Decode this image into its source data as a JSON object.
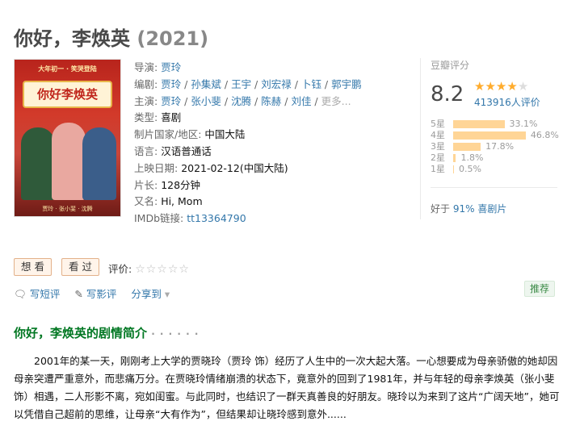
{
  "title": {
    "name": "你好，李焕英",
    "year": "(2021)"
  },
  "poster": {
    "top_text": "大年初一 · 笑哭登陆",
    "title_text": "你好李焕英",
    "bottom_text": "贾玲 · 张小斐 · 沈腾"
  },
  "info": {
    "director_label": "导演: ",
    "director": "贾玲",
    "writer_label": "编剧: ",
    "writers": [
      "贾玲",
      "孙集斌",
      "王宇",
      "刘宏禄",
      "卜钰",
      "郭宇鹏"
    ],
    "cast_label": "主演: ",
    "cast": [
      "贾玲",
      "张小斐",
      "沈腾",
      "陈赫",
      "刘佳"
    ],
    "cast_more": "更多...",
    "genre_label": "类型: ",
    "genre": "喜剧",
    "country_label": "制片国家/地区: ",
    "country": "中国大陆",
    "language_label": "语言: ",
    "language": "汉语普通话",
    "release_label": "上映日期: ",
    "release": "2021-02-12(中国大陆)",
    "runtime_label": "片长: ",
    "runtime": "128分钟",
    "aka_label": "又名: ",
    "aka": "Hi, Mom",
    "imdb_label": "IMDb链接: ",
    "imdb": "tt13364790"
  },
  "rating": {
    "title": "豆瓣评分",
    "score": "8.2",
    "stars_filled": 4,
    "votes": "413916人评价",
    "breakdown": [
      {
        "label": "5星",
        "percent": "33.1%",
        "value": 33.1
      },
      {
        "label": "4星",
        "percent": "46.8%",
        "value": 46.8
      },
      {
        "label": "3星",
        "percent": "17.8%",
        "value": 17.8
      },
      {
        "label": "2星",
        "percent": "1.8%",
        "value": 1.8
      },
      {
        "label": "1星",
        "percent": "0.5%",
        "value": 0.5
      }
    ],
    "better_prefix": "好于 ",
    "better_value": "91% 喜剧片"
  },
  "actions": {
    "want": "想 看",
    "seen": "看 过",
    "rate_label": "评价: ",
    "short_review": "写短评",
    "review": "写影评",
    "share": "分享到",
    "recommend": "推荐"
  },
  "summary": {
    "title": "你好，李焕英的剧情简介",
    "dots": " · · · · · ·",
    "text": "2001年的某一天，刚刚考上大学的贾晓玲（贾玲 饰）经历了人生中的一次大起大落。一心想要成为母亲骄傲的她却因母亲突遭严重意外，而悲痛万分。在贾晓玲情绪崩溃的状态下，竟意外的回到了1981年，并与年轻的母亲李焕英（张小斐 饰）相遇，二人形影不离，宛如闺蜜。与此同时，也结识了一群天真善良的好朋友。晓玲以为来到了这片“广阔天地”，她可以凭借自己超前的思维，让母亲“大有作为”，但结果却让晓玲感到意外......"
  },
  "colors": {
    "link": "#3377aa",
    "star": "#ffac2d",
    "bar": "#ffd596",
    "section": "#007722"
  }
}
